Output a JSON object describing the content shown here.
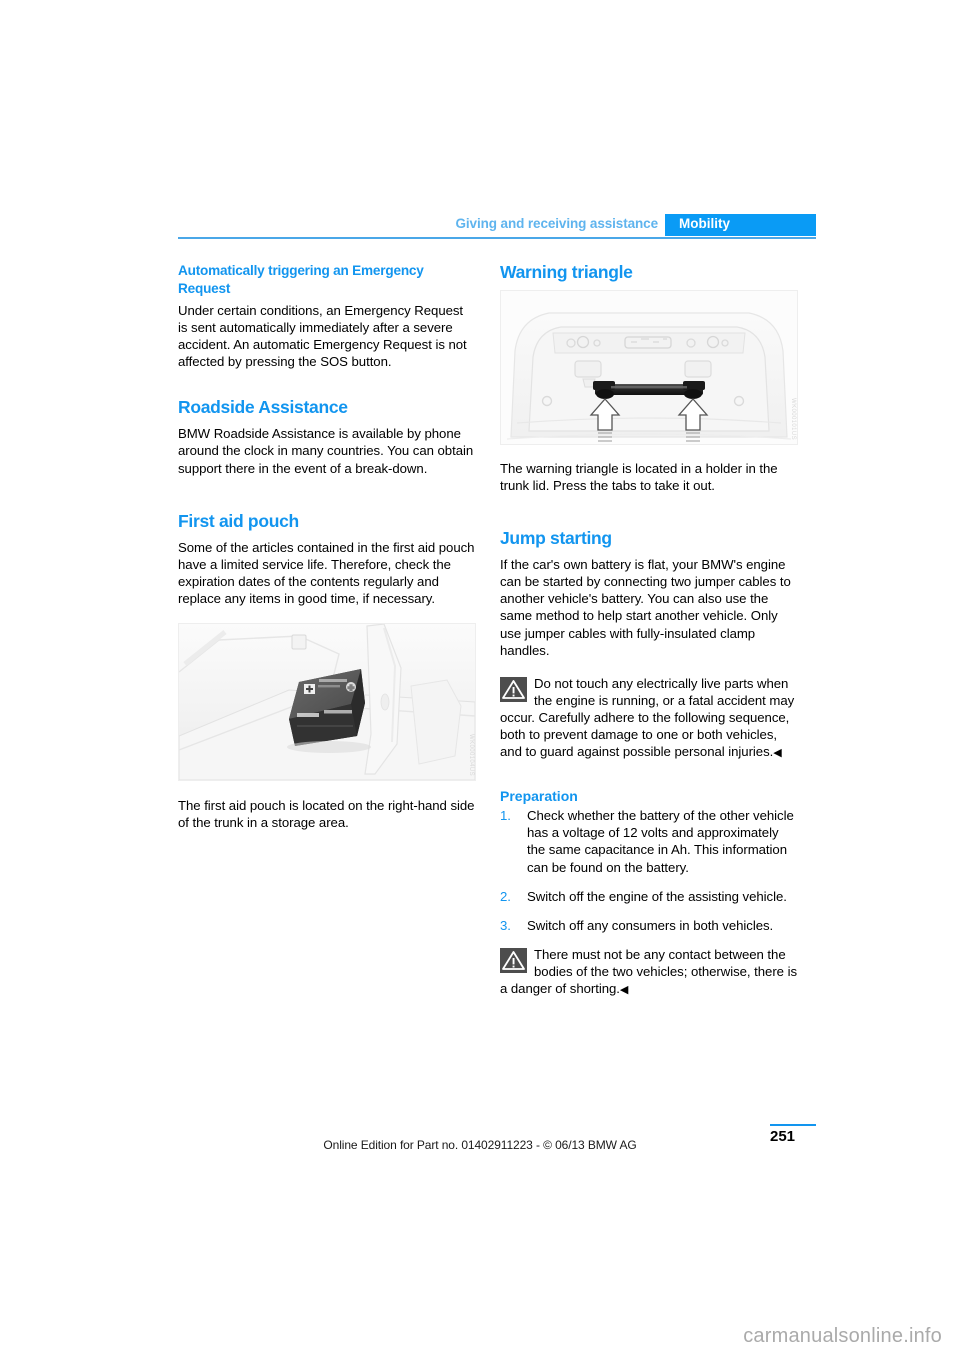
{
  "header": {
    "chapter": "Giving and receiving assistance",
    "section": "Mobility"
  },
  "left_column": {
    "heading_1": "Automatically triggering an Emergency Request",
    "paragraph_1": "Under certain conditions, an Emergency Request is sent automatically immediately after a severe accident. An automatic Emergency Request is not affected by pressing the SOS button.",
    "heading_2": "Roadside Assistance",
    "paragraph_2": "BMW Roadside Assistance is available by phone around the clock in many countries. You can obtain support there in the event of a break-down.",
    "heading_3": "First aid pouch",
    "paragraph_3": "Some of the articles contained in the first aid pouch have a limited service life. Therefore, check the expiration dates of the contents regularly and replace any items in good time, if necessary.",
    "figure_1": {
      "alt": "First aid pouch in right-hand side trunk storage area",
      "code": "WK000104US"
    },
    "paragraph_4": "The first aid pouch is located on the right-hand side of the trunk in a storage area."
  },
  "right_column": {
    "heading_1": "Warning triangle",
    "figure_1": {
      "alt": "Warning triangle holder in trunk lid with press tabs",
      "code": "WK000101US"
    },
    "paragraph_1": "The warning triangle is located in a holder in the trunk lid. Press the tabs to take it out.",
    "heading_2": "Jump starting",
    "paragraph_2": "If the car's own battery is flat, your BMW's engine can be started by connecting two jumper cables to another vehicle's battery. You can also use the same method to help start another vehicle. Only use jumper cables with fully-insulated clamp handles.",
    "warning_1": "Do not touch any electrically live parts when the engine is running, or a fatal accident may occur. Carefully adhere to the following sequence, both to prevent damage to one or both vehicles, and to guard against possible personal injuries.",
    "subheading_1": "Preparation",
    "steps": [
      {
        "num": "1.",
        "text": "Check whether the battery of the other vehicle has a voltage of 12 volts and approximately the same capacitance in Ah. This information can be found on the battery."
      },
      {
        "num": "2.",
        "text": "Switch off the engine of the assisting vehicle."
      },
      {
        "num": "3.",
        "text": "Switch off any consumers in both vehicles."
      }
    ],
    "warning_2": "There must not be any contact between the bodies of the two vehicles; otherwise, there is a danger of shorting.",
    "end_mark": "◀"
  },
  "footer": {
    "page_number": "251",
    "edition": "Online Edition for Part no. 01402911223 - © 06/13 BMW AG",
    "watermark": "carmanualsonline.info"
  },
  "colors": {
    "accent_blue": "#1295ef",
    "header_blue": "#0a9bf5",
    "chapter_blue": "#5fb4ee",
    "warning_icon_bg": "#4d4d4d"
  }
}
